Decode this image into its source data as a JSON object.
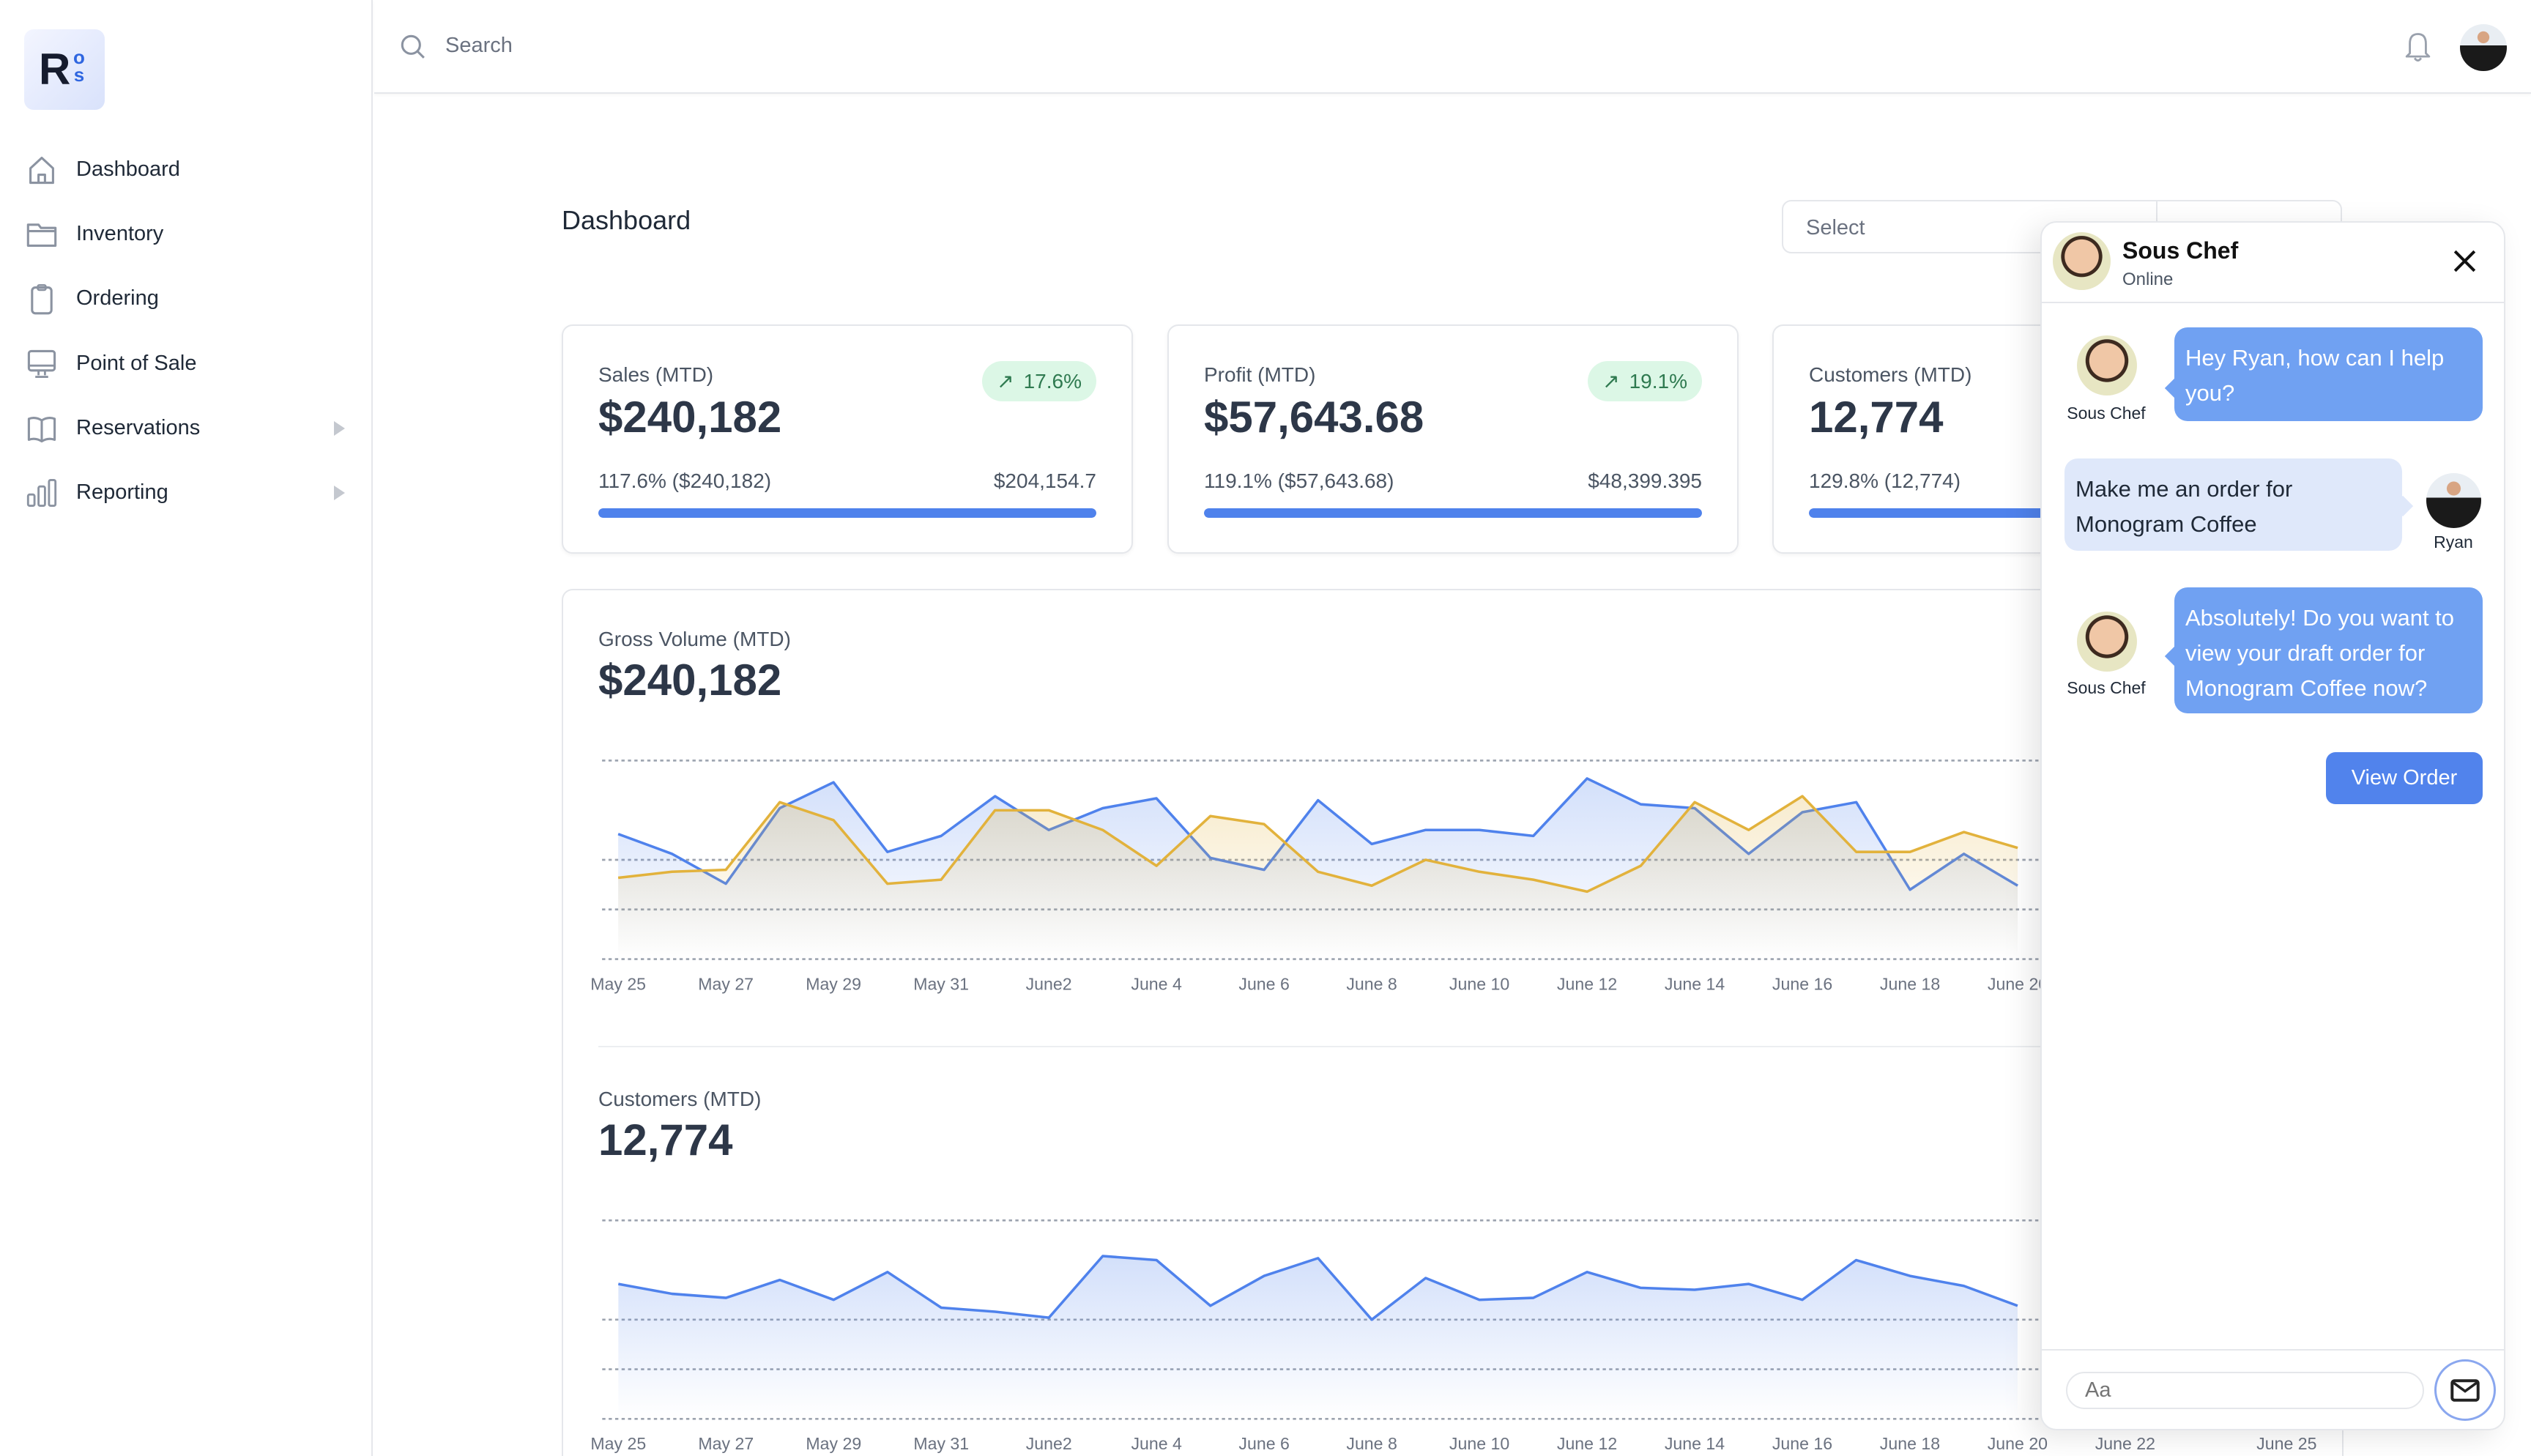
{
  "logo": {
    "text_main": "R",
    "text_accent": "os"
  },
  "sidebar": {
    "items": [
      {
        "label": "Dashboard",
        "icon": "home-icon",
        "has_submenu": false
      },
      {
        "label": "Inventory",
        "icon": "folder-icon",
        "has_submenu": false
      },
      {
        "label": "Ordering",
        "icon": "clipboard-icon",
        "has_submenu": false
      },
      {
        "label": "Point of Sale",
        "icon": "monitor-icon",
        "has_submenu": false
      },
      {
        "label": "Reservations",
        "icon": "book-icon",
        "has_submenu": true
      },
      {
        "label": "Reporting",
        "icon": "bar-chart-icon",
        "has_submenu": true
      }
    ]
  },
  "topbar": {
    "search_placeholder": "Search",
    "icons": [
      "search-icon",
      "bell-icon",
      "user-avatar"
    ]
  },
  "main": {
    "title": "Dashboard",
    "select": {
      "value": "Select"
    },
    "stats": [
      {
        "label": "Sales (MTD)",
        "value": "$240,182",
        "badge": "17.6%",
        "detail": "117.6% ($240,182)",
        "target": "$204,154.7",
        "progress_percent": 100
      },
      {
        "label": "Profit (MTD)",
        "value": "$57,643.68",
        "badge": "19.1%",
        "detail": "119.1% ($57,643.68)",
        "target": "$48,399.395",
        "progress_percent": 100
      },
      {
        "label": "Customers (MTD)",
        "value": "12,774",
        "detail": "129.8% (12,774)",
        "progress_percent": 100
      }
    ],
    "gross_volume": {
      "title": "Gross Volume (MTD)",
      "value": "$240,182"
    },
    "customers": {
      "title": "Customers (MTD)",
      "value": "12,774"
    }
  },
  "colors": {
    "accent": "#4f82ec",
    "series_blue": "#4f82ec",
    "series_gold": "#e2b23c",
    "badge_bg": "#dcf7e6",
    "badge_text": "#2f7a50",
    "bot_bubble": "#70a1f2",
    "user_bubble": "#dfe8fa"
  },
  "chart_data": [
    {
      "type": "area",
      "grid": true,
      "y_axis_labels": false,
      "x": [
        "May 25",
        "May 26",
        "May 27",
        "May 28",
        "May 29",
        "May 30",
        "May 31",
        "June 1",
        "June 2",
        "June 3",
        "June 4",
        "June 5",
        "June 6",
        "June 7",
        "June 8",
        "June 9",
        "June 10",
        "June 11",
        "June 12",
        "June 13",
        "June 14",
        "June 15",
        "June 16",
        "June 17",
        "June 18",
        "June 19",
        "June 20"
      ],
      "tick_labels": [
        "May 25",
        "May 27",
        "May 29",
        "May 31",
        "June2",
        "June 4",
        "June 6",
        "June 8",
        "June 10",
        "June 12",
        "June 14",
        "June 16",
        "June 18",
        "June 20"
      ],
      "ylim": [
        0,
        100
      ],
      "series": [
        {
          "color": "#4f82ec",
          "values": [
            63,
            53,
            38,
            76,
            89,
            54,
            62,
            82,
            65,
            76,
            81,
            51,
            45,
            80,
            58,
            65,
            65,
            62,
            91,
            78,
            76,
            53,
            74,
            79,
            35,
            53,
            37
          ]
        },
        {
          "color": "#e2b23c",
          "values": [
            41,
            44,
            45,
            79,
            70,
            38,
            40,
            75,
            75,
            65,
            47,
            72,
            68,
            44,
            37,
            50,
            44,
            40,
            34,
            47,
            79,
            65,
            82,
            54,
            54,
            64,
            56
          ]
        }
      ]
    },
    {
      "type": "area",
      "grid": true,
      "y_axis_labels": false,
      "x": [
        "May 25",
        "May 26",
        "May 27",
        "May 28",
        "May 29",
        "May 30",
        "May 31",
        "June 1",
        "June 2",
        "June 3",
        "June 4",
        "June 5",
        "June 6",
        "June 7",
        "June 8",
        "June 9",
        "June 10",
        "June 11",
        "June 12",
        "June 13",
        "June 14",
        "June 15",
        "June 16",
        "June 17",
        "June 18",
        "June 19",
        "June 20"
      ],
      "tick_labels": [
        "May 25",
        "May 27",
        "May 29",
        "May 31",
        "June2",
        "June 4",
        "June 6",
        "June 8",
        "June 10",
        "June 12",
        "June 14",
        "June 16",
        "June 18",
        "June 20",
        "June 22",
        "June 25"
      ],
      "ylim": [
        0,
        100
      ],
      "series": [
        {
          "color": "#4f82ec",
          "values": [
            68,
            63,
            61,
            70,
            60,
            74,
            56,
            54,
            51,
            82,
            80,
            57,
            72,
            81,
            50,
            71,
            60,
            61,
            74,
            66,
            65,
            68,
            60,
            80,
            72,
            67,
            57
          ]
        }
      ]
    }
  ],
  "chat": {
    "header": {
      "name": "Sous Chef",
      "status": "Online"
    },
    "messages": [
      {
        "sender": "Sous Chef",
        "text": "Hey Ryan, how can I help you?",
        "from_user": false
      },
      {
        "sender": "Ryan",
        "text": "Make me an order for Monogram Coffee",
        "from_user": true
      },
      {
        "sender": "Sous Chef",
        "text": "Absolutely! Do you want to view your draft order for Monogram Coffee now?",
        "from_user": false
      }
    ],
    "action_button": "View Order",
    "input_placeholder": "Aa"
  }
}
